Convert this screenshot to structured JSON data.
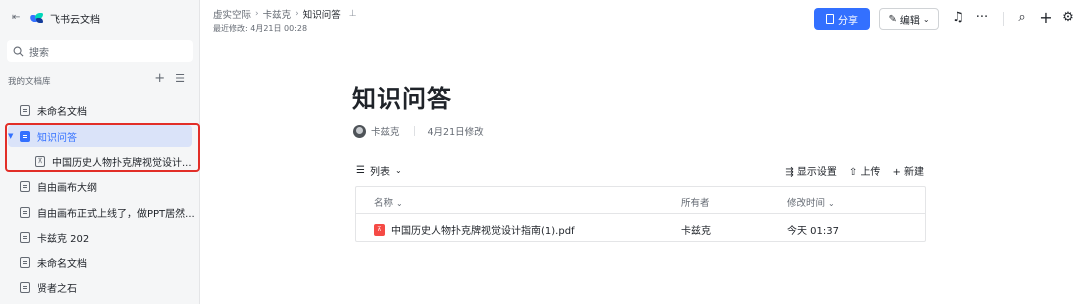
{
  "sidebar": {
    "app_title": "飞书云文档",
    "search_label": "搜索",
    "library_label": "我的文档库",
    "items": [
      {
        "label": "未命名文档"
      },
      {
        "label": "知识问答"
      },
      {
        "label": "中国历史人物扑克牌视觉设计..."
      },
      {
        "label": "自由画布大纲"
      },
      {
        "label": "自由画布正式上线了，做PPT居然..."
      },
      {
        "label": "卡兹克 202"
      },
      {
        "label": "未命名文档"
      },
      {
        "label": "贤者之石"
      }
    ]
  },
  "header": {
    "breadcrumb": [
      "虚实空际",
      "卡兹克",
      "知识问答"
    ],
    "modified": "最近修改: 4月21日 00:28",
    "share_label": "分享",
    "edit_label": "编辑"
  },
  "doc": {
    "title": "知识问答",
    "author": "卡兹克",
    "modified": "4月21日修改",
    "view_label": "列表",
    "actions": {
      "display": "显示设置",
      "upload": "上传",
      "new": "新建"
    }
  },
  "table": {
    "columns": [
      "名称",
      "所有者",
      "修改时间"
    ],
    "rows": [
      {
        "name": "中国历史人物扑克牌视觉设计指南(1).pdf",
        "owner": "卡兹克",
        "modified": "今天 01:37"
      }
    ]
  },
  "colors": {
    "accent": "#3370ff",
    "highlight": "#e22e28",
    "pdf": "#f54a45"
  }
}
